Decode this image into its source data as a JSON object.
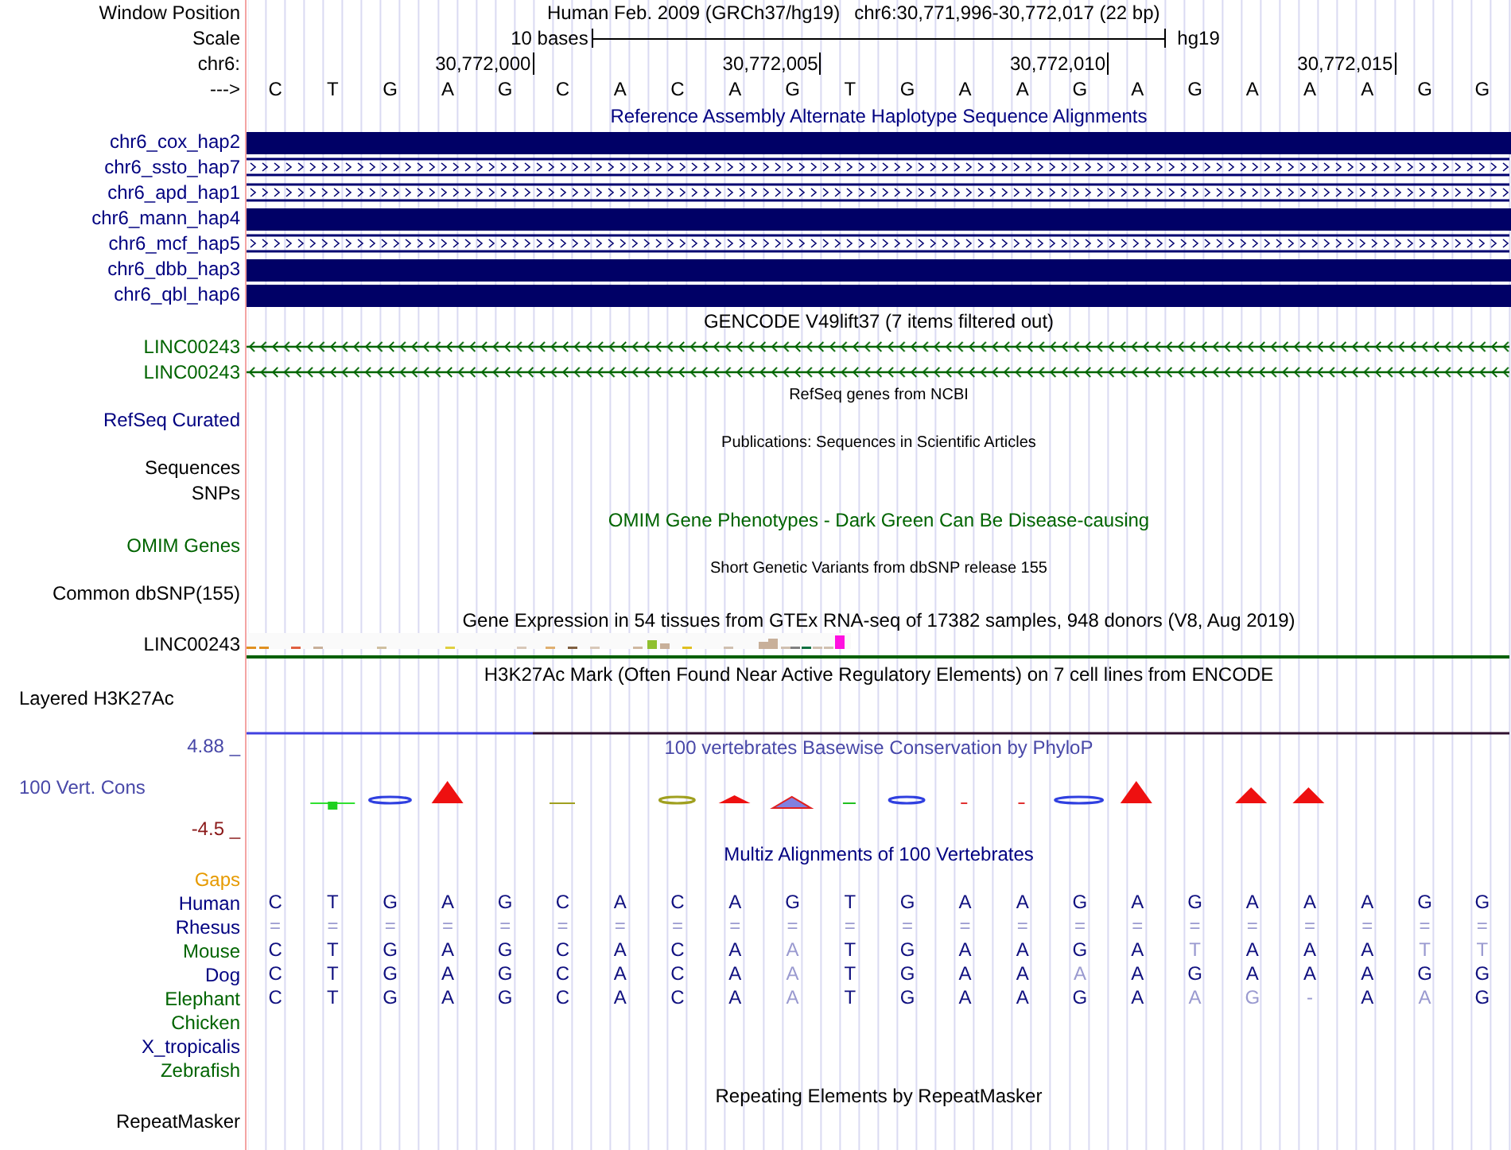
{
  "header": {
    "window_label": "Window Position",
    "assembly": "Human Feb. 2009 (GRCh37/hg19)",
    "position": "chr6:30,771,996-30,772,017 (22 bp)",
    "scale_label": "Scale",
    "scale_text": "10 bases",
    "scale_assembly": "hg19",
    "chrom_label": "chr6:",
    "ticks": [
      "30,772,000",
      "30,772,005",
      "30,772,010",
      "30,772,015"
    ],
    "strand_label": "--->",
    "bases": [
      "C",
      "T",
      "G",
      "A",
      "G",
      "C",
      "A",
      "C",
      "A",
      "G",
      "T",
      "G",
      "A",
      "A",
      "G",
      "A",
      "G",
      "A",
      "A",
      "A",
      "G",
      "G"
    ]
  },
  "tracks": [
    {
      "kind": "title",
      "text": "Reference Assembly Alternate Haplotype Sequence Alignments",
      "color": "#000080"
    },
    {
      "kind": "hap",
      "label": "chr6_cox_hap2",
      "color": "#000080",
      "gapped": false
    },
    {
      "kind": "hap",
      "label": "chr6_ssto_hap7",
      "color": "#000080",
      "gapped": true
    },
    {
      "kind": "hap",
      "label": "chr6_apd_hap1",
      "color": "#000080",
      "gapped": true
    },
    {
      "kind": "hap",
      "label": "chr6_mann_hap4",
      "color": "#000080",
      "gapped": false
    },
    {
      "kind": "hap",
      "label": "chr6_mcf_hap5",
      "color": "#000080",
      "gapped": true
    },
    {
      "kind": "hap",
      "label": "chr6_dbb_hap3",
      "color": "#000080",
      "gapped": false
    },
    {
      "kind": "hap",
      "label": "chr6_qbl_hap6",
      "color": "#000080",
      "gapped": false
    },
    {
      "kind": "title",
      "text": "GENCODE V49lift37 (7 items filtered out)",
      "color": "#000000"
    },
    {
      "kind": "gene",
      "label": "LINC00243",
      "color": "#006400"
    },
    {
      "kind": "gene",
      "label": "LINC00243",
      "color": "#006400"
    },
    {
      "kind": "small-title",
      "text": "RefSeq genes from NCBI",
      "color": "#000000"
    },
    {
      "kind": "label",
      "label": "RefSeq Curated",
      "color": "#000080"
    },
    {
      "kind": "small-title",
      "text": "Publications: Sequences in Scientific Articles",
      "color": "#000000"
    },
    {
      "kind": "label",
      "label": "Sequences",
      "color": "#000000"
    },
    {
      "kind": "label",
      "label": "SNPs",
      "color": "#000000"
    },
    {
      "kind": "title",
      "text": "OMIM Gene Phenotypes - Dark Green Can Be Disease-causing",
      "color": "#006400"
    },
    {
      "kind": "label",
      "label": "OMIM Genes",
      "color": "#006400"
    },
    {
      "kind": "small-title",
      "text": "Short Genetic Variants from dbSNP release 155",
      "color": "#000000"
    },
    {
      "kind": "label",
      "label": "Common dbSNP(155)",
      "color": "#000000"
    },
    {
      "kind": "title",
      "text": "Gene Expression in 54 tissues from GTEx RNA-seq of 17382 samples, 948 donors (V8, Aug 2019)",
      "color": "#000000"
    },
    {
      "kind": "expression",
      "label": "LINC00243",
      "color": "#000000"
    },
    {
      "kind": "title",
      "text": "H3K27Ac Mark (Often Found Near Active Regulatory Elements) on 7 cell lines from ENCODE",
      "color": "#000000"
    },
    {
      "kind": "layered",
      "label": "Layered H3K27Ac",
      "color": "#000000"
    },
    {
      "kind": "conservation",
      "max": "4.88 _",
      "label": "100 Vert. Cons",
      "min": "-4.5 _",
      "title": "100 vertebrates Basewise Conservation by PhyloP",
      "color": "#4848a8"
    },
    {
      "kind": "title",
      "text": "Multiz Alignments of 100 Vertebrates",
      "color": "#000080"
    },
    {
      "kind": "species",
      "label": "Gaps",
      "color": "#e69a00"
    },
    {
      "kind": "alignment",
      "label": "Human",
      "color": "#000080",
      "bases": [
        {
          "base": "C",
          "faded": false
        },
        {
          "base": "T",
          "faded": false
        },
        {
          "base": "G",
          "faded": false
        },
        {
          "base": "A",
          "faded": false
        },
        {
          "base": "G",
          "faded": false
        },
        {
          "base": "C",
          "faded": false
        },
        {
          "base": "A",
          "faded": false
        },
        {
          "base": "C",
          "faded": false
        },
        {
          "base": "A",
          "faded": false
        },
        {
          "base": "G",
          "faded": false
        },
        {
          "base": "T",
          "faded": false
        },
        {
          "base": "G",
          "faded": false
        },
        {
          "base": "A",
          "faded": false
        },
        {
          "base": "A",
          "faded": false
        },
        {
          "base": "G",
          "faded": false
        },
        {
          "base": "A",
          "faded": false
        },
        {
          "base": "G",
          "faded": false
        },
        {
          "base": "A",
          "faded": false
        },
        {
          "base": "A",
          "faded": false
        },
        {
          "base": "A",
          "faded": false
        },
        {
          "base": "G",
          "faded": false
        },
        {
          "base": "G",
          "faded": false
        }
      ]
    },
    {
      "kind": "alignment",
      "label": "Rhesus",
      "color": "#000080",
      "bases": [
        {
          "base": "=",
          "faded": true
        },
        {
          "base": "=",
          "faded": true
        },
        {
          "base": "=",
          "faded": true
        },
        {
          "base": "=",
          "faded": true
        },
        {
          "base": "=",
          "faded": true
        },
        {
          "base": "=",
          "faded": true
        },
        {
          "base": "=",
          "faded": true
        },
        {
          "base": "=",
          "faded": true
        },
        {
          "base": "=",
          "faded": true
        },
        {
          "base": "=",
          "faded": true
        },
        {
          "base": "=",
          "faded": true
        },
        {
          "base": "=",
          "faded": true
        },
        {
          "base": "=",
          "faded": true
        },
        {
          "base": "=",
          "faded": true
        },
        {
          "base": "=",
          "faded": true
        },
        {
          "base": "=",
          "faded": true
        },
        {
          "base": "=",
          "faded": true
        },
        {
          "base": "=",
          "faded": true
        },
        {
          "base": "=",
          "faded": true
        },
        {
          "base": "=",
          "faded": true
        },
        {
          "base": "=",
          "faded": true
        },
        {
          "base": "=",
          "faded": true
        }
      ]
    },
    {
      "kind": "alignment",
      "label": "Mouse",
      "color": "#006400",
      "bases": [
        {
          "base": "C",
          "faded": false
        },
        {
          "base": "T",
          "faded": false
        },
        {
          "base": "G",
          "faded": false
        },
        {
          "base": "A",
          "faded": false
        },
        {
          "base": "G",
          "faded": false
        },
        {
          "base": "C",
          "faded": false
        },
        {
          "base": "A",
          "faded": false
        },
        {
          "base": "C",
          "faded": false
        },
        {
          "base": "A",
          "faded": false
        },
        {
          "base": "A",
          "faded": true
        },
        {
          "base": "T",
          "faded": false
        },
        {
          "base": "G",
          "faded": false
        },
        {
          "base": "A",
          "faded": false
        },
        {
          "base": "A",
          "faded": false
        },
        {
          "base": "G",
          "faded": false
        },
        {
          "base": "A",
          "faded": false
        },
        {
          "base": "T",
          "faded": true
        },
        {
          "base": "A",
          "faded": false
        },
        {
          "base": "A",
          "faded": false
        },
        {
          "base": "A",
          "faded": false
        },
        {
          "base": "T",
          "faded": true
        },
        {
          "base": "T",
          "faded": true
        }
      ]
    },
    {
      "kind": "alignment",
      "label": "Dog",
      "color": "#000080",
      "bases": [
        {
          "base": "C",
          "faded": false
        },
        {
          "base": "T",
          "faded": false
        },
        {
          "base": "G",
          "faded": false
        },
        {
          "base": "A",
          "faded": false
        },
        {
          "base": "G",
          "faded": false
        },
        {
          "base": "C",
          "faded": false
        },
        {
          "base": "A",
          "faded": false
        },
        {
          "base": "C",
          "faded": false
        },
        {
          "base": "A",
          "faded": false
        },
        {
          "base": "A",
          "faded": true
        },
        {
          "base": "T",
          "faded": false
        },
        {
          "base": "G",
          "faded": false
        },
        {
          "base": "A",
          "faded": false
        },
        {
          "base": "A",
          "faded": false
        },
        {
          "base": "A",
          "faded": true
        },
        {
          "base": "A",
          "faded": false
        },
        {
          "base": "G",
          "faded": false
        },
        {
          "base": "A",
          "faded": false
        },
        {
          "base": "A",
          "faded": false
        },
        {
          "base": "A",
          "faded": false
        },
        {
          "base": "G",
          "faded": false
        },
        {
          "base": "G",
          "faded": false
        }
      ]
    },
    {
      "kind": "alignment",
      "label": "Elephant",
      "color": "#006400",
      "bases": [
        {
          "base": "C",
          "faded": false
        },
        {
          "base": "T",
          "faded": false
        },
        {
          "base": "G",
          "faded": false
        },
        {
          "base": "A",
          "faded": false
        },
        {
          "base": "G",
          "faded": false
        },
        {
          "base": "C",
          "faded": false
        },
        {
          "base": "A",
          "faded": false
        },
        {
          "base": "C",
          "faded": false
        },
        {
          "base": "A",
          "faded": false
        },
        {
          "base": "A",
          "faded": true
        },
        {
          "base": "T",
          "faded": false
        },
        {
          "base": "G",
          "faded": false
        },
        {
          "base": "A",
          "faded": false
        },
        {
          "base": "A",
          "faded": false
        },
        {
          "base": "G",
          "faded": false
        },
        {
          "base": "A",
          "faded": false
        },
        {
          "base": "A",
          "faded": true
        },
        {
          "base": "G",
          "faded": true
        },
        {
          "base": "-",
          "faded": true
        },
        {
          "base": "A",
          "faded": false
        },
        {
          "base": "A",
          "faded": true
        },
        {
          "base": "G",
          "faded": false
        }
      ]
    },
    {
      "kind": "species",
      "label": "Chicken",
      "color": "#006400"
    },
    {
      "kind": "species",
      "label": "X_tropicalis",
      "color": "#000080"
    },
    {
      "kind": "species",
      "label": "Zebrafish",
      "color": "#006400"
    },
    {
      "kind": "title",
      "text": "Repeating Elements by RepeatMasker",
      "color": "#000000"
    },
    {
      "kind": "label",
      "label": "RepeatMasker",
      "color": "#000000"
    }
  ]
}
